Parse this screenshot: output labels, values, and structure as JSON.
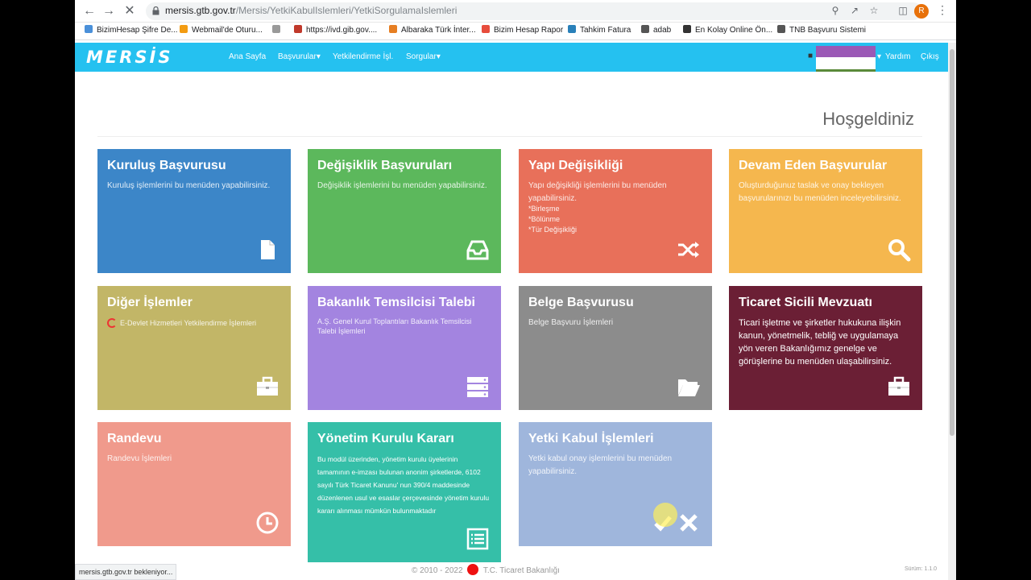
{
  "browser": {
    "url_host": "mersis.gtb.gov.tr",
    "url_path": "/Mersis/YetkiKabulIslemleri/YetkiSorgulamaIslemleri",
    "avatar_letter": "R",
    "status_text": "mersis.gtb.gov.tr bekleniyor..."
  },
  "bookmarks": [
    {
      "label": "BizimHesap Şifre De...",
      "color": "#4a90d9"
    },
    {
      "label": "Webmail'de Oturu...",
      "color": "#f39c12"
    },
    {
      "label": "",
      "color": "#999999"
    },
    {
      "label": "https://ivd.gib.gov....",
      "color": "#c0392b"
    },
    {
      "label": "Albaraka Türk İnter...",
      "color": "#e67e22"
    },
    {
      "label": "Bizim Hesap Rapor",
      "color": "#e74c3c"
    },
    {
      "label": "Tahkim Fatura",
      "color": "#2980b9"
    },
    {
      "label": "adab",
      "color": "#555555"
    },
    {
      "label": "En Kolay Online Ön...",
      "color": "#333333"
    },
    {
      "label": "TNB Başvuru Sistemi",
      "color": "#555555"
    }
  ],
  "site": {
    "logo": "MERSİS",
    "nav": {
      "home": "Ana Sayfa",
      "applications": "Başvurular",
      "authorization": "Yetkilendirme İşl.",
      "queries": "Sorgular",
      "help": "Yardım",
      "logout": "Çıkış"
    },
    "flag_colors": [
      "#9b59b6",
      "#ffffff",
      "#5a8a3a"
    ],
    "welcome": "Hoşgeldiniz"
  },
  "tiles": [
    {
      "title": "Kuruluş Başvurusu",
      "desc": "Kuruluş işlemlerini bu menüden yapabilirsiniz.",
      "color": "#3c86c8",
      "icon": "file-icon"
    },
    {
      "title": "Değişiklik Başvuruları",
      "desc": "Değişiklik işlemlerini bu menüden yapabilirsiniz.",
      "color": "#5cb85c",
      "icon": "inbox-icon"
    },
    {
      "title": "Yapı Değişikliği",
      "desc": "Yapı değişikliği işlemlerini bu menüden yapabilirsiniz.",
      "sub": [
        "*Birleşme",
        "*Bölünme",
        "*Tür Değişikliği"
      ],
      "color": "#e8705a",
      "icon": "shuffle-icon"
    },
    {
      "title": "Devam Eden Başvurular",
      "desc": "Oluşturduğunuz taslak ve onay bekleyen başvurularınızı bu menüden inceleyebilirsiniz.",
      "color": "#f5b74e",
      "icon": "search-icon"
    },
    {
      "title": "Diğer İşlemler",
      "desc": "E-Devlet Hizmetleri Yetkilendirme İşlemleri",
      "color": "#c2b667",
      "icon": "briefcase-icon"
    },
    {
      "title": "Bakanlık Temsilcisi Talebi",
      "desc": "A.Ş. Genel Kurul Toplantıları Bakanlık Temsilcisi Talebi İşlemleri",
      "color": "#a384e0",
      "icon": "server-icon"
    },
    {
      "title": "Belge Başvurusu",
      "desc": "Belge Başvuru İşlemleri",
      "color": "#8c8c8c",
      "icon": "folder-open-icon"
    },
    {
      "title": "Ticaret Sicili Mevzuatı",
      "desc": "Ticari işletme ve şirketler hukukuna ilişkin kanun, yönetmelik, tebliğ ve uygulamaya yön veren Bakanlığımız genelge ve görüşlerine bu menüden ulaşabilirsiniz.",
      "color": "#6b1f35",
      "icon": "briefcase-icon"
    },
    {
      "title": "Randevu",
      "desc": "Randevu İşlemleri",
      "color": "#f09a8c",
      "icon": "clock-icon"
    },
    {
      "title": "Yönetim Kurulu Kararı",
      "desc": "Bu modül üzerinden, yönetim kurulu üyelerinin tamamının e-imzası bulunan anonim şirketlerde, 6102 sayılı Türk Ticaret Kanunu' nun 390/4 maddesinde düzenlenen usul ve esaslar çerçevesinde yönetim kurulu kararı alınması mümkün bulunmaktadır",
      "color": "#35bfa8",
      "icon": "list-alt-icon"
    },
    {
      "title": "Yetki Kabul İşlemleri",
      "desc": "Yetki kabul onay işlemlerini bu menüden yapabilirsiniz.",
      "color": "#9fb6dc",
      "icon": "check-cross-icon"
    }
  ],
  "footer": {
    "copyright": "© 2010 - 2022",
    "ministry": "T.C. Ticaret Bakanlığı",
    "version": "Sürüm: 1.1.0"
  }
}
